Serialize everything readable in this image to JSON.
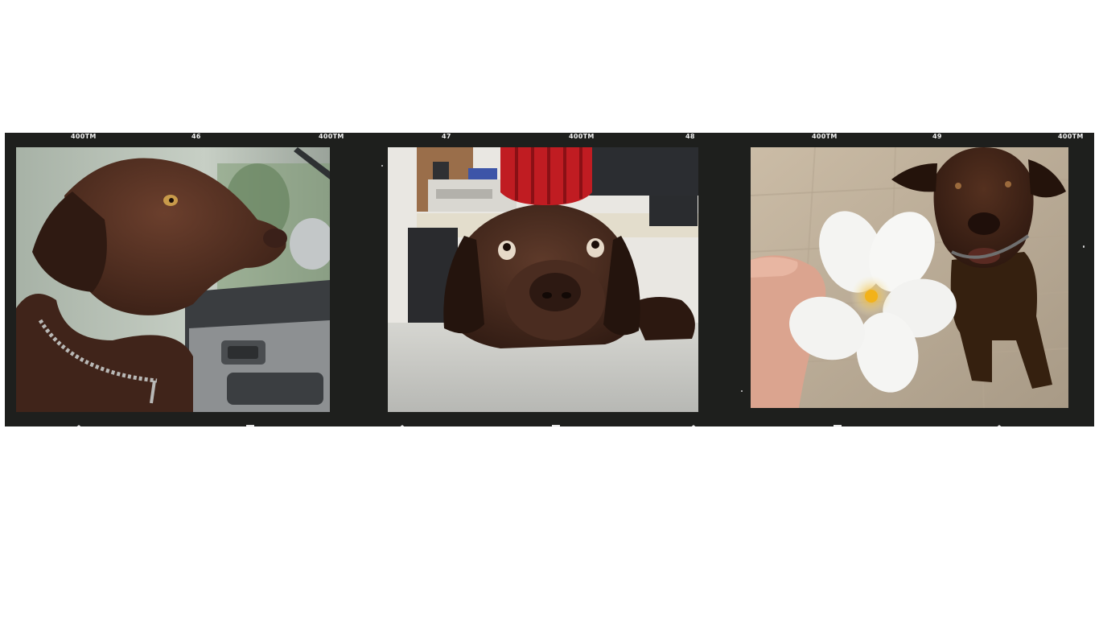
{
  "film": {
    "frame_numbers": [
      "46",
      "47",
      "48",
      "49"
    ],
    "film_code": "400TM",
    "base_color": "#1e1f1d",
    "edge_text_color": "#f2f2f2"
  },
  "frames": [
    {
      "subject": "chocolate-labrador-in-car",
      "main_colors": [
        "#4a2a1e",
        "#9aa59a",
        "#3a3d40"
      ]
    },
    {
      "subject": "chocolate-labrador-with-red-toy-on-head",
      "main_colors": [
        "#3e241c",
        "#c01c22",
        "#d8d8d2"
      ]
    },
    {
      "subject": "chocolate-labrador-with-white-flower",
      "main_colors": [
        "#3a2018",
        "#f4f4f2",
        "#b8a890"
      ]
    }
  ]
}
